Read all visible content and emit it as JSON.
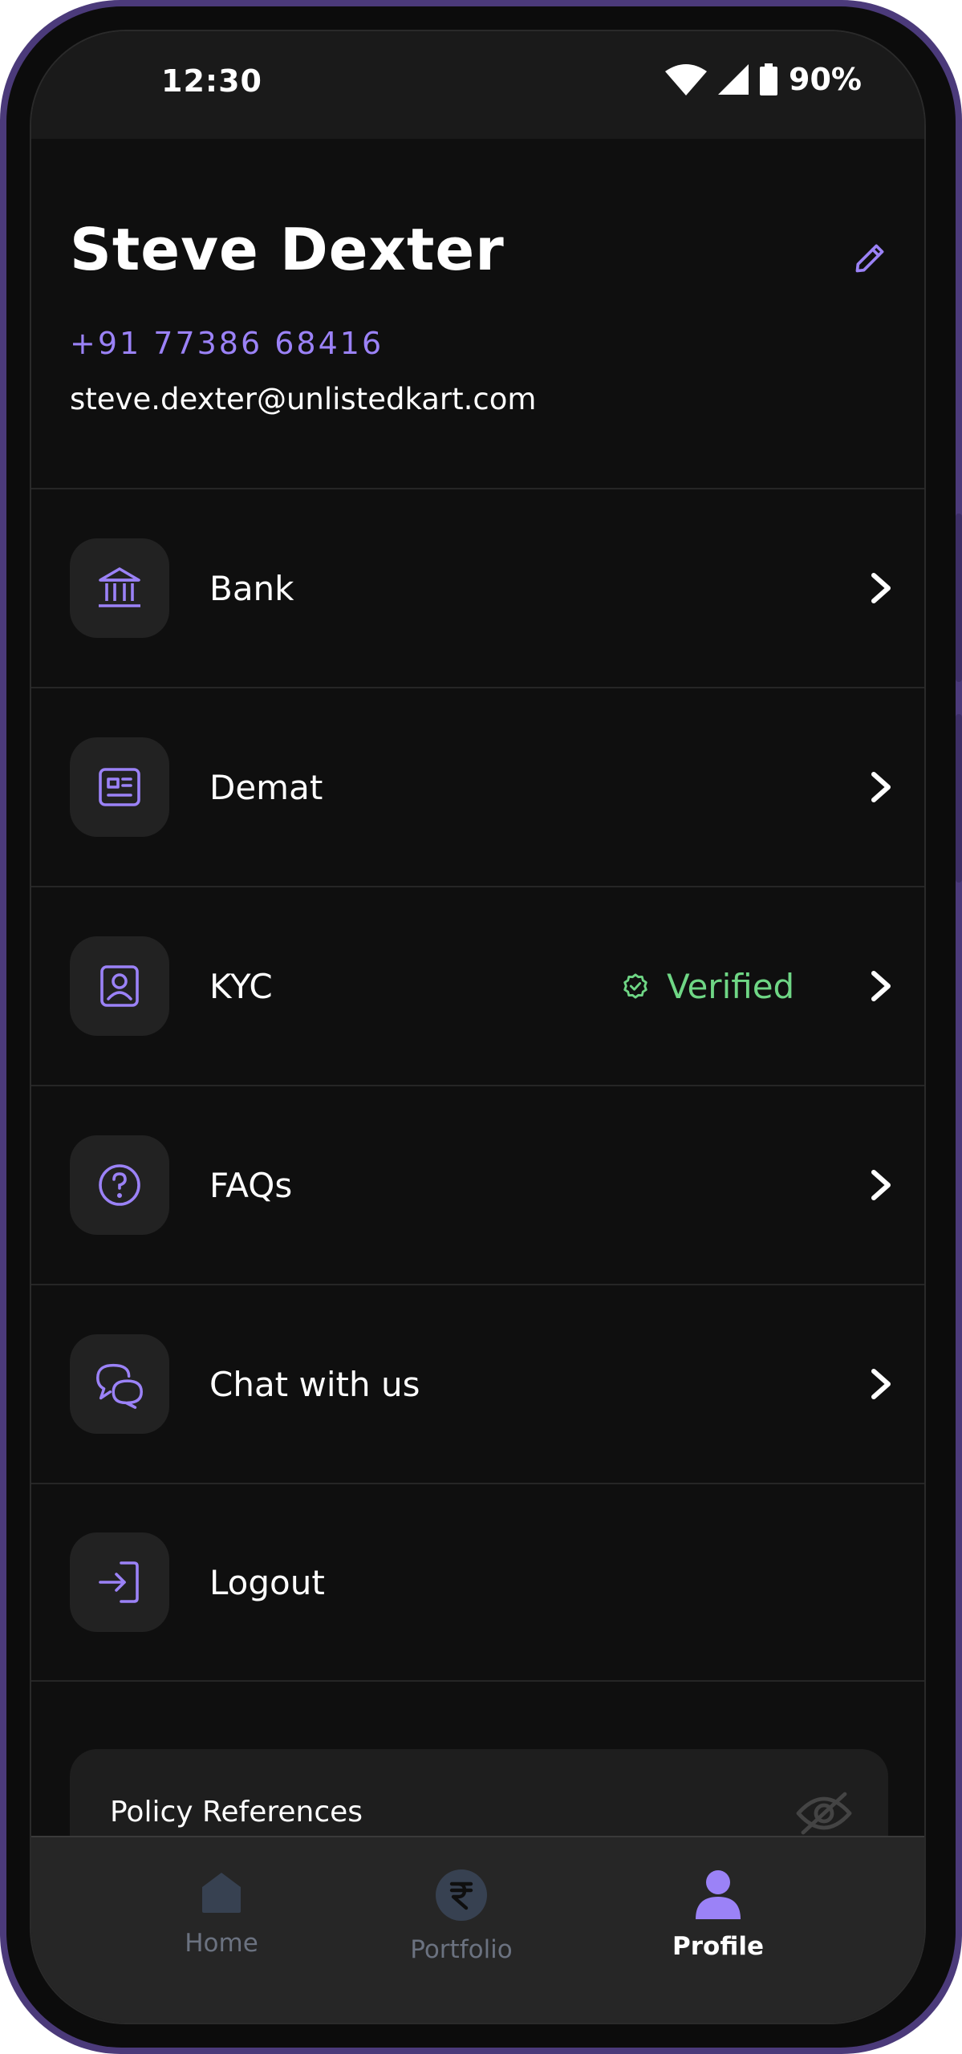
{
  "status_bar": {
    "time": "12:30",
    "battery": "90%"
  },
  "profile": {
    "name": "Steve Dexter",
    "phone": "+91 77386 68416",
    "email": "steve.dexter@unlistedkart.com"
  },
  "menu": {
    "items": [
      {
        "label": "Bank",
        "icon": "bank-icon"
      },
      {
        "label": "Demat",
        "icon": "id-card-icon"
      },
      {
        "label": "KYC",
        "icon": "user-badge-icon",
        "status": "Verified"
      },
      {
        "label": "FAQs",
        "icon": "question-circle-icon"
      },
      {
        "label": "Chat with us",
        "icon": "chat-bubbles-icon"
      },
      {
        "label": "Logout",
        "icon": "logout-icon"
      }
    ]
  },
  "policy": {
    "title": "Policy References"
  },
  "bottom_nav": {
    "items": [
      {
        "label": "Home",
        "icon": "home-icon",
        "active": false
      },
      {
        "label": "Portfolio",
        "icon": "rupee-icon",
        "active": false
      },
      {
        "label": "Profile",
        "icon": "profile-icon",
        "active": true
      }
    ]
  },
  "colors": {
    "accent": "#9b82f7",
    "success": "#6fd685",
    "background": "#0f0f0f",
    "nav_inactive": "#6b7280",
    "frame": "#4b3a7a"
  }
}
